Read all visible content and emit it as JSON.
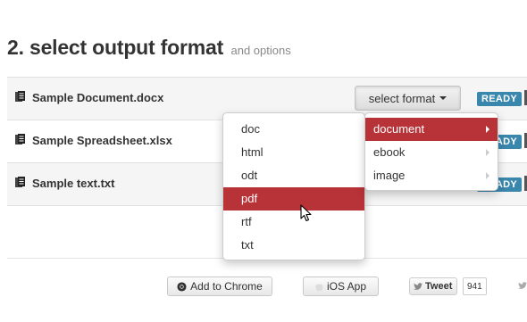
{
  "heading": {
    "title": "2. select output format",
    "subtitle": "and options"
  },
  "files": [
    {
      "name": "Sample Document.docx",
      "icon": "document-icon"
    },
    {
      "name": "Sample Spreadsheet.xlsx",
      "icon": "document-icon"
    },
    {
      "name": "Sample text.txt",
      "icon": "document-icon"
    }
  ],
  "select_button": {
    "label": "select format"
  },
  "status": {
    "ready": "READY"
  },
  "format_menu": {
    "items": [
      "doc",
      "html",
      "odt",
      "pdf",
      "rtf",
      "txt"
    ],
    "highlighted": "pdf"
  },
  "category_menu": {
    "items": [
      "document",
      "ebook",
      "image"
    ],
    "highlighted": "document"
  },
  "footer": {
    "chrome_label": "Add to Chrome",
    "ios_label": "iOS App",
    "tweet_label": "Tweet",
    "tweet_count": "941"
  },
  "colors": {
    "accent": "#b73338",
    "ready_badge": "#3a87ad"
  }
}
